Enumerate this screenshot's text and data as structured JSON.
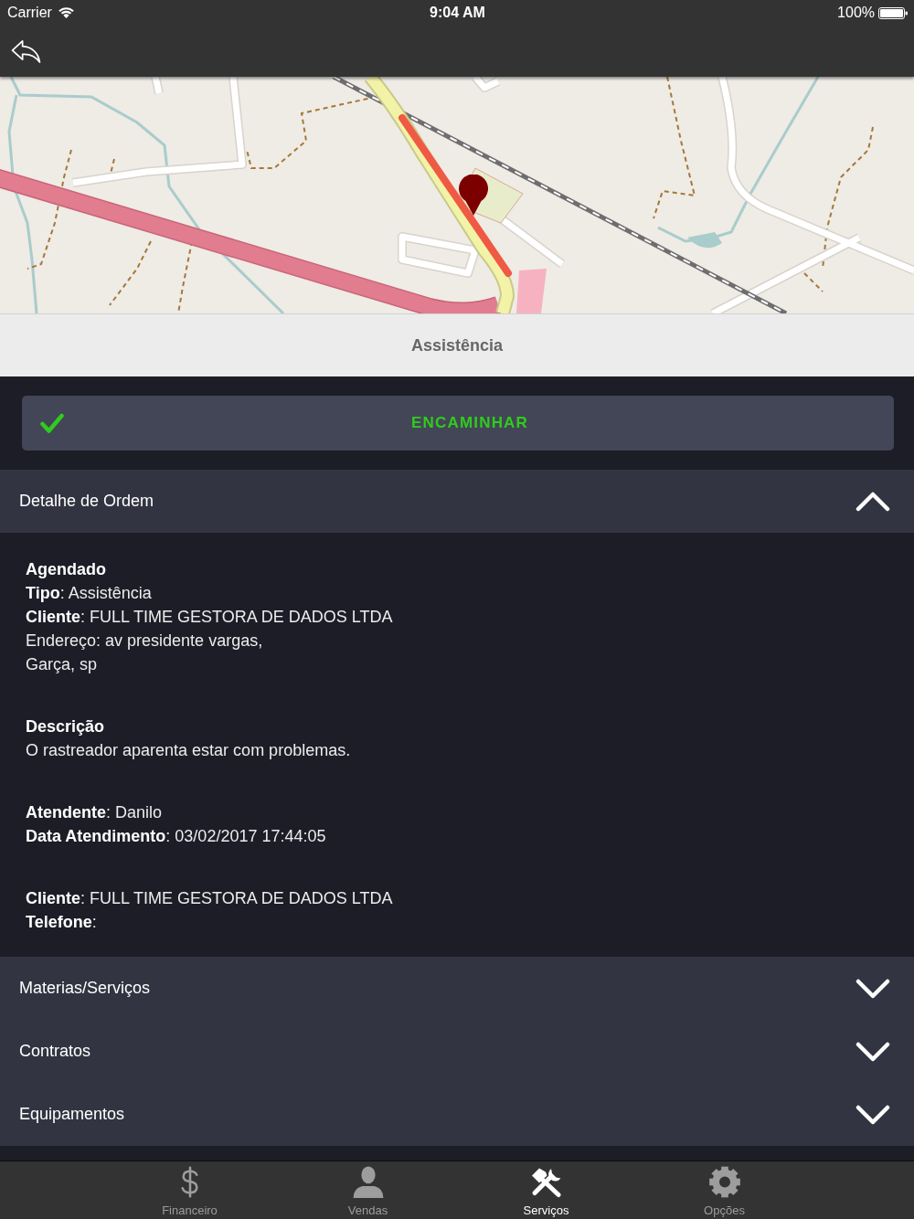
{
  "status_bar": {
    "carrier": "Carrier",
    "time": "9:04 AM",
    "battery": "100%"
  },
  "title": "Assistência",
  "action_button": {
    "label": "ENCAMINHAR"
  },
  "sections": [
    {
      "title": "Detalhe de Ordem",
      "expanded": true,
      "blocks": [
        [
          {
            "kind": "heading",
            "text": "Agendado"
          },
          {
            "kind": "field",
            "text": "**Tipo**: Assistência"
          },
          {
            "kind": "field",
            "text": "**Cliente**: FULL TIME GESTORA DE DADOS LTDA"
          },
          {
            "kind": "field",
            "text": "Endereço: av presidente vargas,"
          },
          {
            "kind": "field",
            "text": "Garça, sp"
          }
        ],
        [
          {
            "kind": "heading",
            "text": "Descrição"
          },
          {
            "kind": "field",
            "text": "O rastreador aparenta estar com problemas."
          }
        ],
        [
          {
            "kind": "field",
            "text": "**Atendente**: Danilo"
          },
          {
            "kind": "field",
            "text": "**Data Atendimento**: 03/02/2017 17:44:05"
          }
        ],
        [
          {
            "kind": "field",
            "text": "**Cliente**: FULL TIME GESTORA DE DADOS LTDA"
          },
          {
            "kind": "field",
            "text": "**Telefone**:"
          }
        ]
      ]
    },
    {
      "title": "Materias/Serviços",
      "expanded": false
    },
    {
      "title": "Contratos",
      "expanded": false
    },
    {
      "title": "Equipamentos",
      "expanded": false
    }
  ],
  "tab_bar": {
    "tabs": [
      {
        "label": "Financeiro",
        "selected": false
      },
      {
        "label": "Vendas",
        "selected": false
      },
      {
        "label": "Serviços",
        "selected": true
      },
      {
        "label": "Opções",
        "selected": false
      }
    ]
  }
}
